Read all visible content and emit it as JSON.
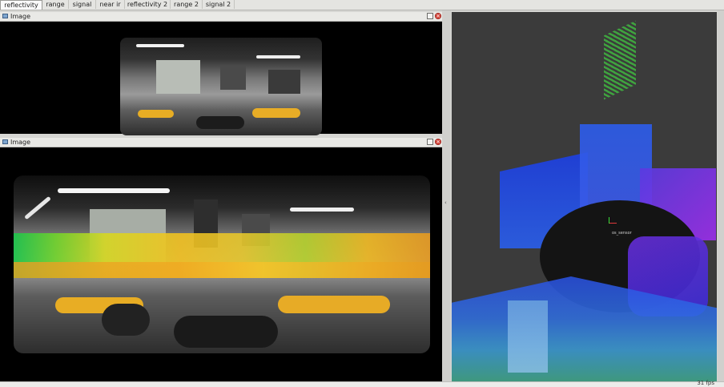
{
  "tabs": [
    {
      "label": "reflectivity",
      "active": true
    },
    {
      "label": "range",
      "active": false
    },
    {
      "label": "signal",
      "active": false
    },
    {
      "label": "near ir",
      "active": false
    },
    {
      "label": "reflectivity 2",
      "active": false
    },
    {
      "label": "range 2",
      "active": false
    },
    {
      "label": "signal 2",
      "active": false
    }
  ],
  "panels": {
    "top": {
      "title": "Image",
      "float_icon": "float-icon",
      "close_icon": "close-icon"
    },
    "bottom": {
      "title": "Image",
      "float_icon": "float-icon",
      "close_icon": "close-icon"
    }
  },
  "viewer3d": {
    "frame_label": "os_sensor",
    "splitter_handle": "‹"
  },
  "status": {
    "fps": "31 fps"
  },
  "colors": {
    "panel_bg": "#000000",
    "viewer_bg": "#3b3b3b",
    "tab_active": "#fafafa",
    "close_red": "#d8443a"
  }
}
